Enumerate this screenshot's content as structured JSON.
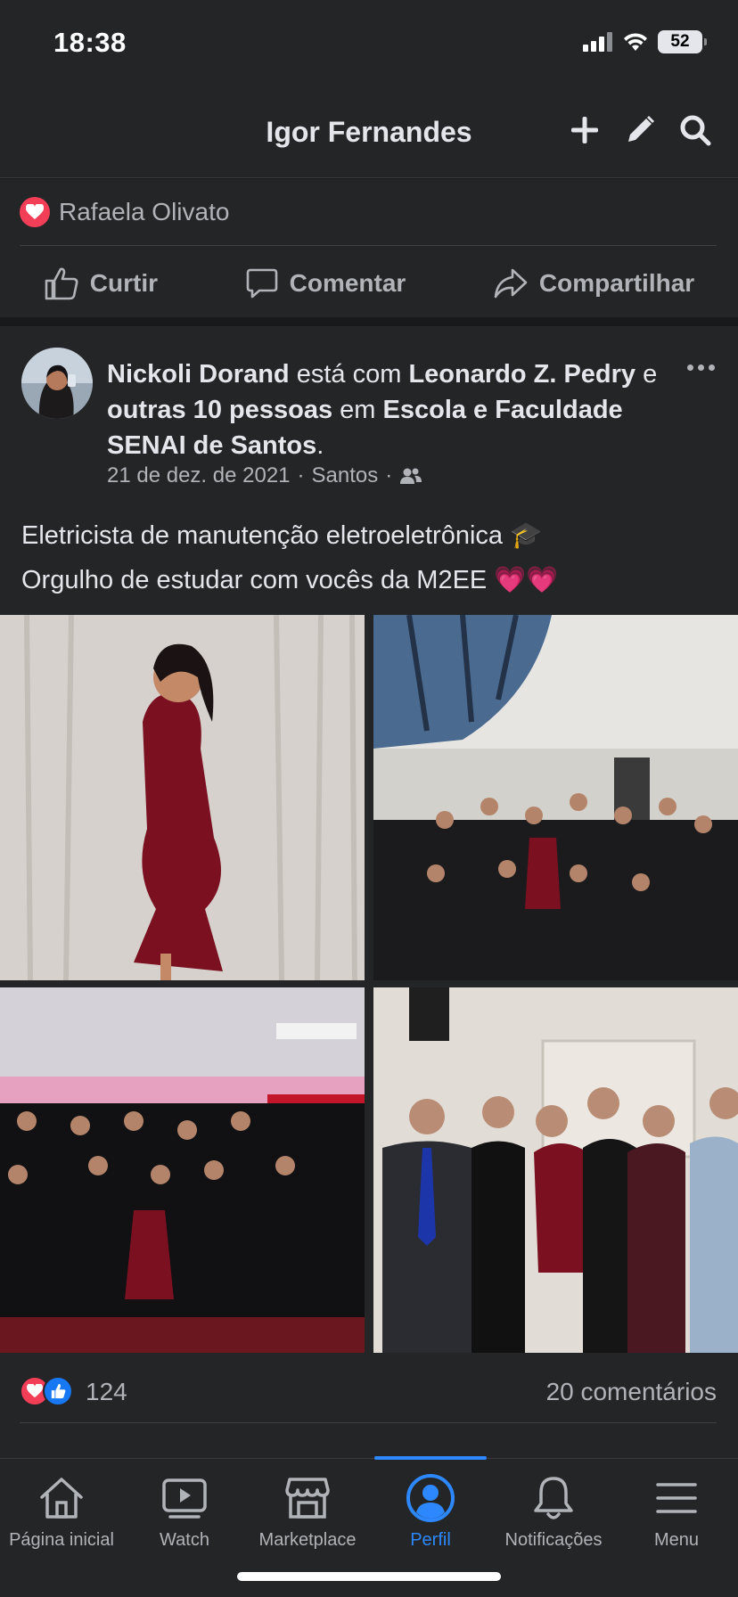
{
  "status_bar": {
    "time": "18:38",
    "battery": "52"
  },
  "header": {
    "title": "Igor Fernandes"
  },
  "previous_post": {
    "reactor": "Rafaela Olivato",
    "actions": {
      "like": "Curtir",
      "comment": "Comentar",
      "share": "Compartilhar"
    }
  },
  "post": {
    "author": "Nickoli Dorand",
    "with_text": "está com",
    "tagged": "Leonardo Z. Pedry",
    "and_text": "e",
    "others": "outras 10 pessoas",
    "at_text": "em",
    "place": "Escola e Faculdade SENAI de Santos",
    "period": ".",
    "date": "21 de dez. de 2021",
    "location": "Santos",
    "sep": "·",
    "privacy_icon": "friends-icon",
    "text_line1": "Eletricista de manutenção eletroeletrônica 🎓",
    "text_line2": "Orgulho de estudar com vocês da M2EE 💗💗",
    "reaction_count": "124",
    "comments": "20 comentários"
  },
  "tabs": [
    {
      "label": "Página inicial",
      "icon": "home-icon"
    },
    {
      "label": "Watch",
      "icon": "watch-icon"
    },
    {
      "label": "Marketplace",
      "icon": "marketplace-icon"
    },
    {
      "label": "Perfil",
      "icon": "profile-icon"
    },
    {
      "label": "Notificações",
      "icon": "bell-icon"
    },
    {
      "label": "Menu",
      "icon": "menu-icon"
    }
  ],
  "colors": {
    "accent": "#2d88ff",
    "love": "#f33e58",
    "bg": "#242526"
  }
}
